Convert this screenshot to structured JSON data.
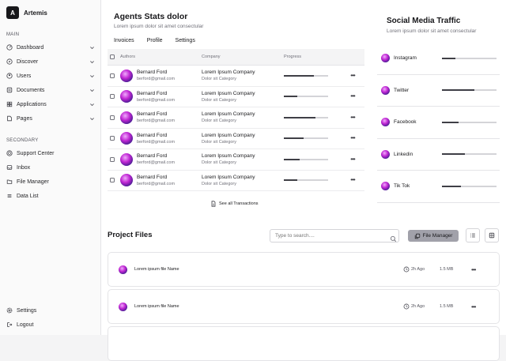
{
  "app": {
    "logo_letter": "A",
    "name": "Artemis"
  },
  "sidebar": {
    "main_label": "MAIN",
    "main_items": [
      {
        "label": "Dashboard",
        "icon": "dashboard-icon"
      },
      {
        "label": "Discover",
        "icon": "compass-icon"
      },
      {
        "label": "Users",
        "icon": "users-icon"
      },
      {
        "label": "Documents",
        "icon": "documents-icon"
      },
      {
        "label": "Applications",
        "icon": "apps-icon"
      },
      {
        "label": "Pages",
        "icon": "pages-icon"
      }
    ],
    "secondary_label": "SECONDARY",
    "secondary_items": [
      {
        "label": "Support Center",
        "icon": "support-icon"
      },
      {
        "label": "Inbox",
        "icon": "inbox-icon"
      },
      {
        "label": "File Manager",
        "icon": "folder-icon"
      },
      {
        "label": "Data List",
        "icon": "list-icon"
      }
    ],
    "bottom_items": [
      {
        "label": "Settings",
        "icon": "gear-icon"
      },
      {
        "label": "Logout",
        "icon": "logout-icon"
      }
    ]
  },
  "agents": {
    "title": "Agents Stats dolor",
    "subtitle": "Lorem ipsum dolor sit amet consectular",
    "tabs": [
      "Invoices",
      "Profile",
      "Settings"
    ],
    "columns": {
      "authors": "Authors",
      "company": "Company",
      "progress": "Progress"
    },
    "rows": [
      {
        "name": "Bernard Ford",
        "email": "berford@gmail.com",
        "company": "Lorem Ipsum Company",
        "category": "Dolor sit Category",
        "progress": 0.68
      },
      {
        "name": "Bernard Ford",
        "email": "berford@gmail.com",
        "company": "Lorem Ipsum Company",
        "category": "Dolor sit Category",
        "progress": 0.3
      },
      {
        "name": "Bernard Ford",
        "email": "berford@gmail.com",
        "company": "Lorem Ipsum Company",
        "category": "Dolor sit Category",
        "progress": 0.72
      },
      {
        "name": "Bernard Ford",
        "email": "berford@gmail.com",
        "company": "Lorem Ipsum Company",
        "category": "Dolor sit Category",
        "progress": 0.45
      },
      {
        "name": "Bernard Ford",
        "email": "berford@gmail.com",
        "company": "Lorem Ipsum Company",
        "category": "Dolor sit Category",
        "progress": 0.35
      },
      {
        "name": "Bernard Ford",
        "email": "berford@gmail.com",
        "company": "Lorem Ipsum Company",
        "category": "Dolor sit Category",
        "progress": 0.3
      }
    ],
    "see_all": "See all Transactions"
  },
  "social": {
    "title": "Social Media Traffic",
    "subtitle": "Lorem ipsum dolor sit amet consectular",
    "items": [
      {
        "name": "Instagram",
        "progress": 0.25
      },
      {
        "name": "Twitter",
        "progress": 0.6
      },
      {
        "name": "Facebook",
        "progress": 0.3
      },
      {
        "name": "Linkedin",
        "progress": 0.42
      },
      {
        "name": "Tik Tok",
        "progress": 0.35
      }
    ]
  },
  "project_files": {
    "title": "Project Files",
    "search_placeholder": "Type to search....",
    "file_manager_label": "File Manager",
    "files": [
      {
        "name": "Lorem ipsum file Name",
        "time": "2h Ago",
        "size": "1.5 MB"
      },
      {
        "name": "Lorem ipsum file Name",
        "time": "2h Ago",
        "size": "1.5 MB"
      }
    ]
  },
  "colors": {
    "accent": "#18181b",
    "muted": "#71717a",
    "track": "#d4d4d8"
  }
}
